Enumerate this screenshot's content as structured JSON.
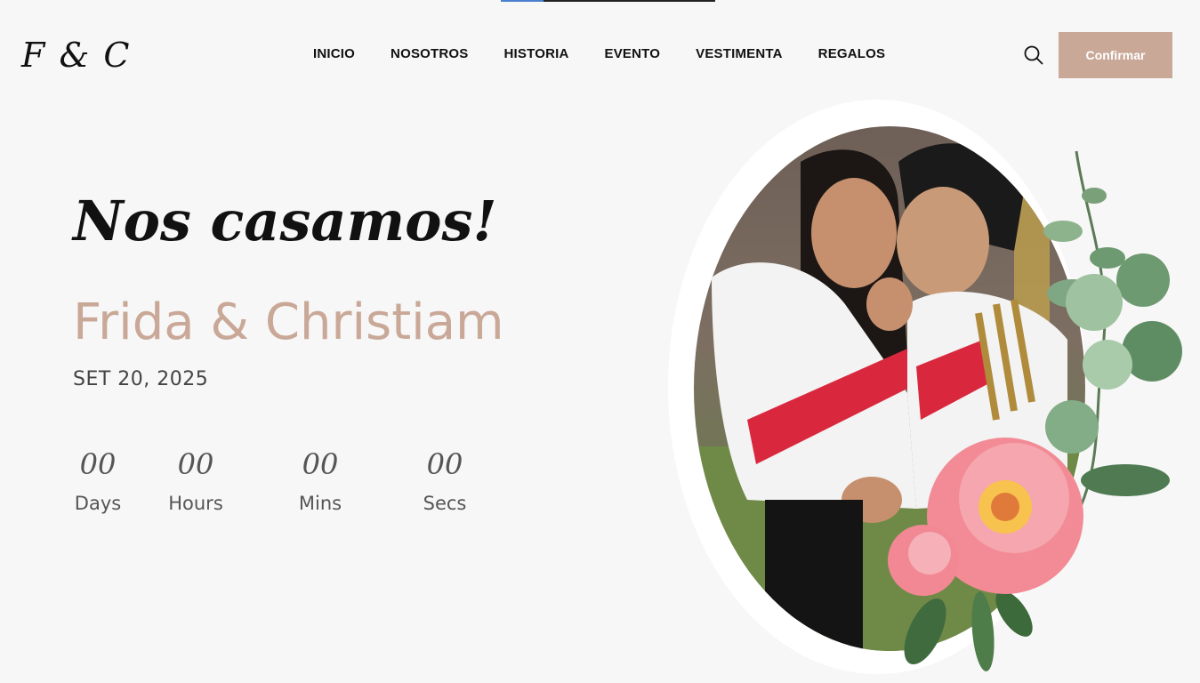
{
  "header": {
    "logo": "F & C",
    "nav": [
      "INICIO",
      "NOSOTROS",
      "HISTORIA",
      "EVENTO",
      "VESTIMENTA",
      "REGALOS"
    ],
    "confirm_label": "Confirmar",
    "scroll_progress": 0.2
  },
  "hero": {
    "title": "Nos casamos!",
    "couple": "Frida & Christiam",
    "date": "SET 20, 2025"
  },
  "countdown": [
    {
      "value": "00",
      "label": "Days"
    },
    {
      "value": "00",
      "label": "Hours"
    },
    {
      "value": "00",
      "label": "Mins"
    },
    {
      "value": "00",
      "label": "Secs"
    }
  ],
  "colors": {
    "accent": "#c9a898",
    "background": "#f7f7f7",
    "text": "#111111"
  },
  "icons": [
    "search-icon",
    "flower-bouquet"
  ]
}
